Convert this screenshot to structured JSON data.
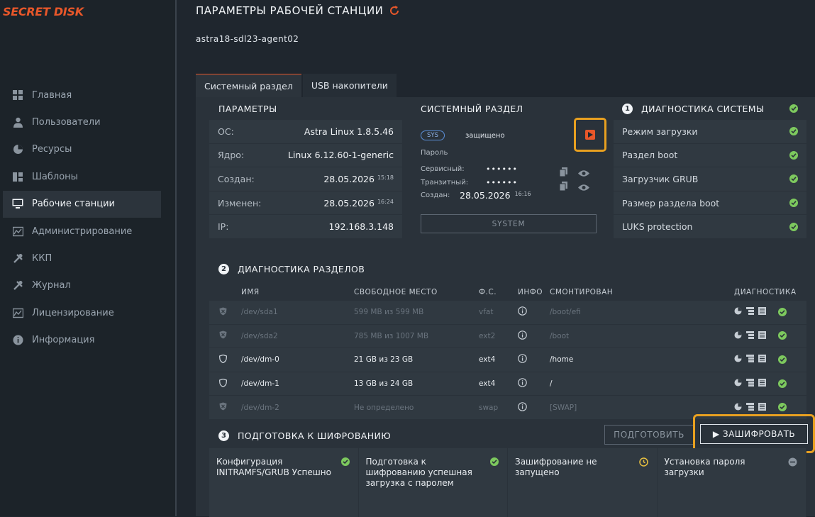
{
  "app": {
    "logo": "SECRET DISK"
  },
  "sidebar": {
    "items": [
      {
        "label": "Главная",
        "icon": "dashboard-icon"
      },
      {
        "label": "Пользователи",
        "icon": "user-icon"
      },
      {
        "label": "Ресурсы",
        "icon": "pie-icon"
      },
      {
        "label": "Шаблоны",
        "icon": "template-icon"
      },
      {
        "label": "Рабочие станции",
        "icon": "monitor-icon",
        "active": true
      },
      {
        "label": "Администрирование",
        "icon": "chart-icon"
      },
      {
        "label": "ККП",
        "icon": "tools-icon"
      },
      {
        "label": "Журнал",
        "icon": "tools-icon"
      },
      {
        "label": "Лицензирование",
        "icon": "chart-icon"
      },
      {
        "label": "Информация",
        "icon": "info-icon"
      }
    ]
  },
  "header": {
    "title": "ПАРАМЕТРЫ РАБОЧЕЙ СТАНЦИИ",
    "hostname": "astra18-sdl23-agent02"
  },
  "tabs": [
    {
      "label": "Системный раздел",
      "active": true
    },
    {
      "label": "USB накопители"
    }
  ],
  "params": {
    "heading": "ПАРАМЕТРЫ",
    "rows": [
      {
        "key": "ОС:",
        "value": "Astra Linux 1.8.5.46",
        "time": ""
      },
      {
        "key": "Ядро:",
        "value": "Linux 6.12.60-1-generic",
        "time": ""
      },
      {
        "key": "Создан:",
        "value": "28.05.2026",
        "time": "15:18"
      },
      {
        "key": "Изменен:",
        "value": "28.05.2026",
        "time": "16:24"
      },
      {
        "key": "IP:",
        "value": "192.168.3.148",
        "time": ""
      }
    ]
  },
  "system_partition": {
    "heading": "СИСТЕМНЫЙ РАЗДЕЛ",
    "badge": "SYS",
    "status": "защищено",
    "password_label": "Пароль",
    "service_label": "Сервисный:",
    "service_value": "••••••",
    "transit_label": "Транзитный:",
    "transit_value": "••••••",
    "created_label": "Создан:",
    "created_value": "28.05.2026",
    "created_time": "16:16",
    "system_button": "SYSTEM"
  },
  "diagnostics": {
    "number": "1",
    "heading": "ДИАГНОСТИКА СИСТЕМЫ",
    "rows": [
      "Режим загрузки",
      "Раздел boot",
      "Загрузчик GRUB",
      "Размер раздела boot",
      "LUKS protection"
    ]
  },
  "partitions": {
    "number": "2",
    "heading": "ДИАГНОСТИКА РАЗДЕЛОВ",
    "columns": [
      "ИМЯ",
      "СВОБОДНОЕ МЕСТО",
      "Ф.С.",
      "ИНФО",
      "СМОНТИРОВАН",
      "ДИАГНОСТИКА"
    ],
    "rows": [
      {
        "name": "/dev/sda1",
        "free": "599 MB из 599 MB",
        "fs": "vfat",
        "mount": "/boot/efi",
        "dim": true
      },
      {
        "name": "/dev/sda2",
        "free": "785 MB из 1007 MB",
        "fs": "ext2",
        "mount": "/boot",
        "dim": true
      },
      {
        "name": "/dev/dm-0",
        "free": "21 GB из 23 GB",
        "fs": "ext4",
        "mount": "/home",
        "dim": false
      },
      {
        "name": "/dev/dm-1",
        "free": "13 GB из 24 GB",
        "fs": "ext4",
        "mount": "/",
        "dim": false
      },
      {
        "name": "/dev/dm-2",
        "free": "Не определено",
        "fs": "swap",
        "mount": "[SWAP]",
        "dim": true
      }
    ]
  },
  "prep": {
    "number": "3",
    "heading": "ПОДГОТОВКА К ШИФРОВАНИЮ",
    "prepare_button": "ПОДГОТОВИТЬ",
    "encrypt_button": "▶ ЗАШИФРОВАТЬ",
    "cards": [
      {
        "text": "Конфигурация INITRAMFS/GRUB Успешно",
        "status": "ok"
      },
      {
        "text": "Подготовка к шифрованию успешная загрузка с паролем",
        "status": "ok"
      },
      {
        "text": "Зашифрование не запущено",
        "status": "pending"
      },
      {
        "text": "Установка пароля загрузки",
        "status": "disabled"
      }
    ]
  },
  "colors": {
    "accent": "#e8572a",
    "ok": "#7dc95e",
    "warning": "#e8a020"
  }
}
